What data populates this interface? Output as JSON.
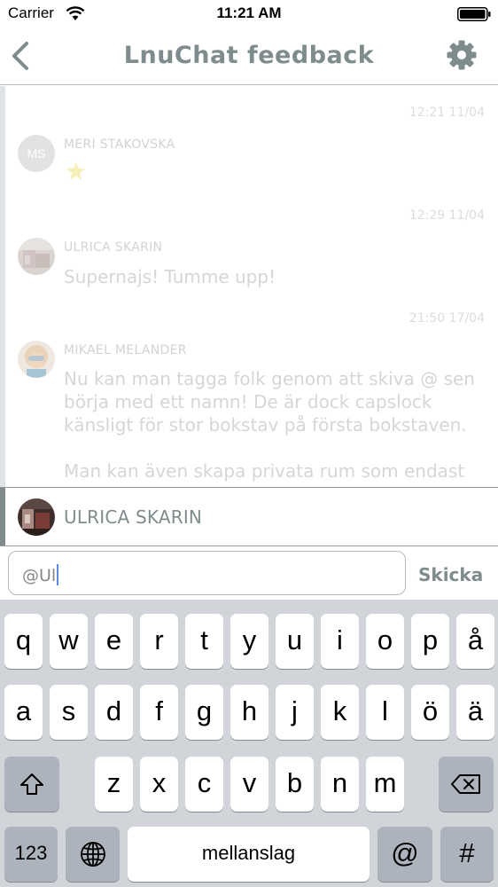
{
  "status_bar": {
    "carrier": "Carrier",
    "time": "11:21 AM"
  },
  "nav": {
    "title": "LnuChat feedback",
    "back_icon": "chevron-left-icon",
    "settings_icon": "gear-icon"
  },
  "messages": [
    {
      "timestamp": "12:21 11/04",
      "author": "MERI STAKOVSKA",
      "initials": "MS",
      "text": "",
      "emoji": "★"
    },
    {
      "timestamp": "12:29 11/04",
      "author": "ULRICA SKARIN",
      "text": "Supernajs! Tumme upp!"
    },
    {
      "timestamp": "21:50 17/04",
      "author": "MIKAEL MELANDER",
      "text": "Nu kan man tagga folk genom att skiva @ sen börja med ett namn! De är dock capslock känsligt för stor bokstav på första bokstaven.\n\nMan kan även skapa privata rum som endast"
    }
  ],
  "suggestion": {
    "name": "ULRICA SKARIN"
  },
  "composer": {
    "value": "@Ul",
    "send_label": "Skicka"
  },
  "keyboard": {
    "row1": [
      "q",
      "w",
      "e",
      "r",
      "t",
      "y",
      "u",
      "i",
      "o",
      "p",
      "å"
    ],
    "row2": [
      "a",
      "s",
      "d",
      "f",
      "g",
      "h",
      "j",
      "k",
      "l",
      "ö",
      "ä"
    ],
    "row3": [
      "z",
      "x",
      "c",
      "v",
      "b",
      "n",
      "m"
    ],
    "numbers_label": "123",
    "space_label": "mellanslag",
    "at_label": "@",
    "hash_label": "#",
    "shift_icon": "shift-icon",
    "backspace_icon": "backspace-icon",
    "globe_icon": "globe-icon"
  }
}
